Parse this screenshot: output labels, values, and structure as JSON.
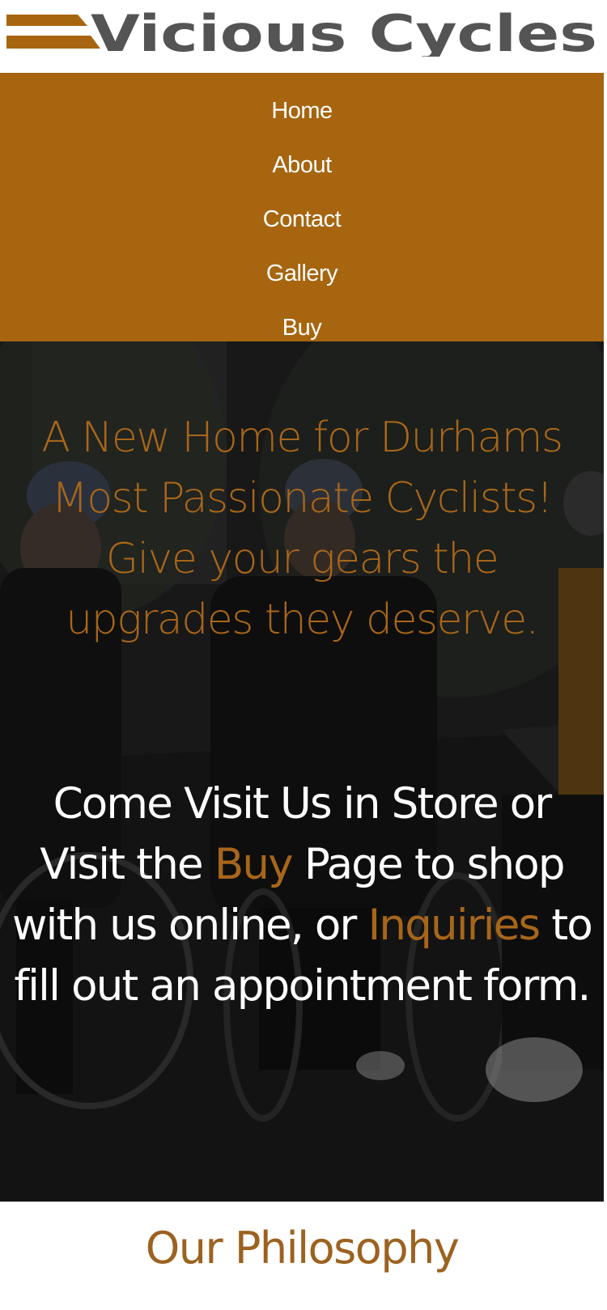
{
  "brand": {
    "name": "Vicious Cycles",
    "logo_icon": "speed-lines-icon",
    "accent_color": "#a7650f",
    "text_color": "#545454"
  },
  "nav": {
    "items": [
      {
        "label": "Home"
      },
      {
        "label": "About"
      },
      {
        "label": "Contact"
      },
      {
        "label": "Gallery"
      },
      {
        "label": "Buy"
      }
    ]
  },
  "hero": {
    "background_image": "cyclists-group-photo",
    "tagline": "A New Home for Durhams Most Passionate Cyclists! Give your gears the upgrades they deserve.",
    "visit": {
      "part1": "Come Visit Us in Store or Visit the ",
      "buy_link": "Buy",
      "part2": " Page to shop with us online, or ",
      "inquiries_link": "Inquiries",
      "part3": " to fill out an appointment form."
    }
  },
  "philosophy": {
    "heading": "Our Philosophy"
  }
}
